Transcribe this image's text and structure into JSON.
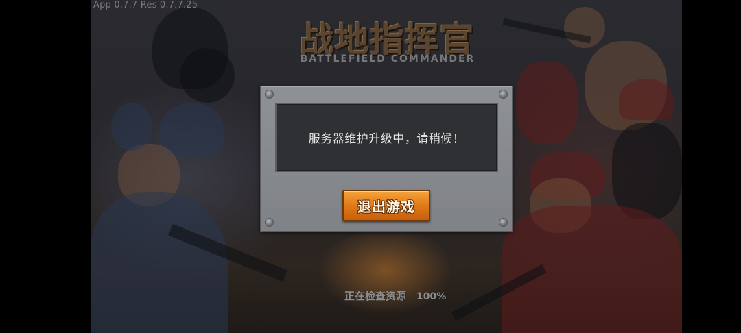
{
  "header": {
    "version_text": "App 0.7.7 Res 0.7.7.25"
  },
  "logo": {
    "title_cn": "战地指挥官",
    "subtitle_en": "BATTLEFIELD COMMANDER"
  },
  "dialog": {
    "message": "服务器维护升级中，请稍候！",
    "exit_button_label": "退出游戏"
  },
  "loading": {
    "status_text": "正在检查资源",
    "percent_text": "100%",
    "progress": 1.0
  },
  "colors": {
    "button_orange": "#e07a17",
    "panel_gray": "#8e9196",
    "message_bg": "#2f3033"
  },
  "icons": [
    "bolt-icon"
  ]
}
